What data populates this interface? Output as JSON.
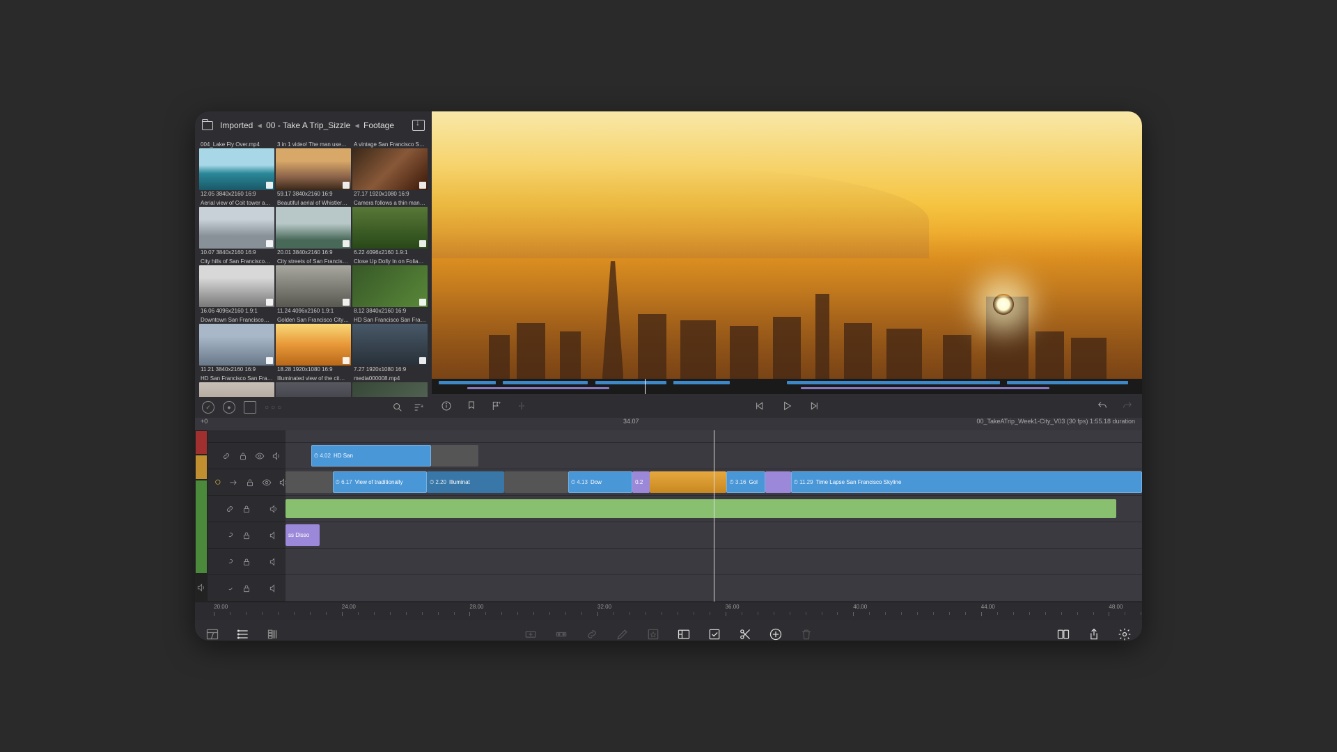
{
  "breadcrumb": {
    "a": "Imported",
    "b": "00 - Take A Trip_Sizzle",
    "c": "Footage"
  },
  "clips": [
    {
      "title": "004_Lake Fly Over.mp4",
      "meta": "12.05  3840x2160  16:9",
      "g": "g-lake"
    },
    {
      "title": "3 in 1 video! The man use…",
      "meta": "59.17  3840x2160  16:9",
      "g": "g-sunset"
    },
    {
      "title": "A vintage San Francisco S…",
      "meta": "27.17  1920x1080  16:9",
      "g": "g-bar"
    },
    {
      "title": "Aerial view of Coit tower a…",
      "meta": "10.07  3840x2160  16:9",
      "g": "g-aerial"
    },
    {
      "title": "Beautiful aerial of Whistler…",
      "meta": "20.01  3840x2160  16:9",
      "g": "g-river"
    },
    {
      "title": "Camera follows a thin man…",
      "meta": "6.22  4096x2160  1.9:1",
      "g": "g-forest"
    },
    {
      "title": "City hills of San Francisco…",
      "meta": "16.06  4096x2160  1.9:1",
      "g": "g-city"
    },
    {
      "title": "City streets of San Francis…",
      "meta": "11.24  4096x2160  1.9:1",
      "g": "g-street"
    },
    {
      "title": "Close Up Dolly In on Folia…",
      "meta": "8.12  3840x2160  16:9",
      "g": "g-foliage"
    },
    {
      "title": "Downtown San Francisco…",
      "meta": "11.21  3840x2160  16:9",
      "g": "g-downtown"
    },
    {
      "title": "Golden San Francisco City…",
      "meta": "18.28  1920x1080  16:9",
      "g": "g-golden"
    },
    {
      "title": "HD San Francisco San Fra…",
      "meta": "7.27  1920x1080  16:9",
      "g": "g-hdnight"
    },
    {
      "title": "HD San Francisco San Fra…",
      "meta": "",
      "g": "g-houses"
    },
    {
      "title": "Illuminated view of the cit…",
      "meta": "",
      "g": "g-illum"
    },
    {
      "title": "media000008.mp4",
      "meta": "",
      "g": "g-media"
    }
  ],
  "header": {
    "zoom": "+0",
    "playtime": "34.07",
    "project": "00_TakeATrip_Week1-City_V03 (30 fps)  1:55.18 duration"
  },
  "timeline_clips": {
    "v2": [
      {
        "l": 3,
        "w": 14,
        "t": "4.02  HD San",
        "cls": "vid"
      },
      {
        "l": 17,
        "w": 5.5,
        "cls": "thumb g-downtown"
      }
    ],
    "v1": [
      {
        "l": 0,
        "w": 5.5,
        "cls": "thumb g-city"
      },
      {
        "l": 5.5,
        "w": 11,
        "t": "6.17  View of traditionally",
        "cls": "vid"
      },
      {
        "l": 16.5,
        "w": 9,
        "t": "2.20  Illuminat",
        "cls": "vid2"
      },
      {
        "l": 25.5,
        "w": 7.5,
        "cls": "thumb g-aerial"
      },
      {
        "l": 33,
        "w": 7.5,
        "t": "4.13  Dow",
        "cls": "vid"
      },
      {
        "l": 40.5,
        "w": 2,
        "t": "0.2",
        "cls": "trans"
      },
      {
        "l": 42.5,
        "w": 9,
        "cls": "orange"
      },
      {
        "l": 51.5,
        "w": 4.5,
        "t": "3.16  Gol",
        "cls": "vid"
      },
      {
        "l": 56,
        "w": 3,
        "cls": "trans"
      },
      {
        "l": 59,
        "w": 41,
        "t": "11.29   Time Lapse San Francisco Skyline",
        "cls": "vid"
      }
    ],
    "a1": [
      {
        "l": 0,
        "w": 97,
        "cls": "aud"
      }
    ],
    "a2": [
      {
        "l": 0,
        "w": 4,
        "t": "ss Disso",
        "cls": "trans"
      }
    ]
  },
  "ruler": [
    "20.00",
    "24.00",
    "28.00",
    "32.00",
    "36.00",
    "40.00",
    "44.00",
    "48.00"
  ],
  "playhead_pct": 50
}
